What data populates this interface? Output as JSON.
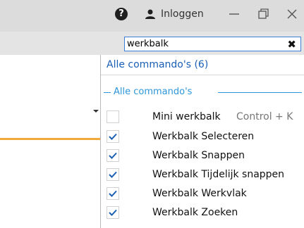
{
  "titlebar": {
    "help_icon": "question-circle-icon",
    "user_icon": "user-icon",
    "login_label": "Inloggen",
    "minimize_icon": "minimize-icon",
    "maximize_icon": "restore-icon",
    "close_icon": "close-icon"
  },
  "search": {
    "value": "werkbalk",
    "clear_icon": "close-icon",
    "clear_glyph": "✖"
  },
  "results": {
    "all_label": "Alle commando's (6)",
    "group_label": "Alle commando's",
    "items": [
      {
        "label": "Mini werkbalk",
        "shortcut": "Control + K",
        "checked": false
      },
      {
        "label": "Werkbalk Selecteren",
        "shortcut": "",
        "checked": true
      },
      {
        "label": "Werkbalk Snappen",
        "shortcut": "",
        "checked": true
      },
      {
        "label": "Werkbalk Tijdelijk snappen",
        "shortcut": "",
        "checked": true
      },
      {
        "label": "Werkbalk Werkvlak",
        "shortcut": "",
        "checked": true
      },
      {
        "label": "Werkbalk Zoeken",
        "shortcut": "",
        "checked": true
      }
    ]
  },
  "colors": {
    "accent": "#1a5fb4",
    "group_header": "#2d96d8",
    "check": "#1a5fb4",
    "orange_line": "#f2a93b"
  }
}
